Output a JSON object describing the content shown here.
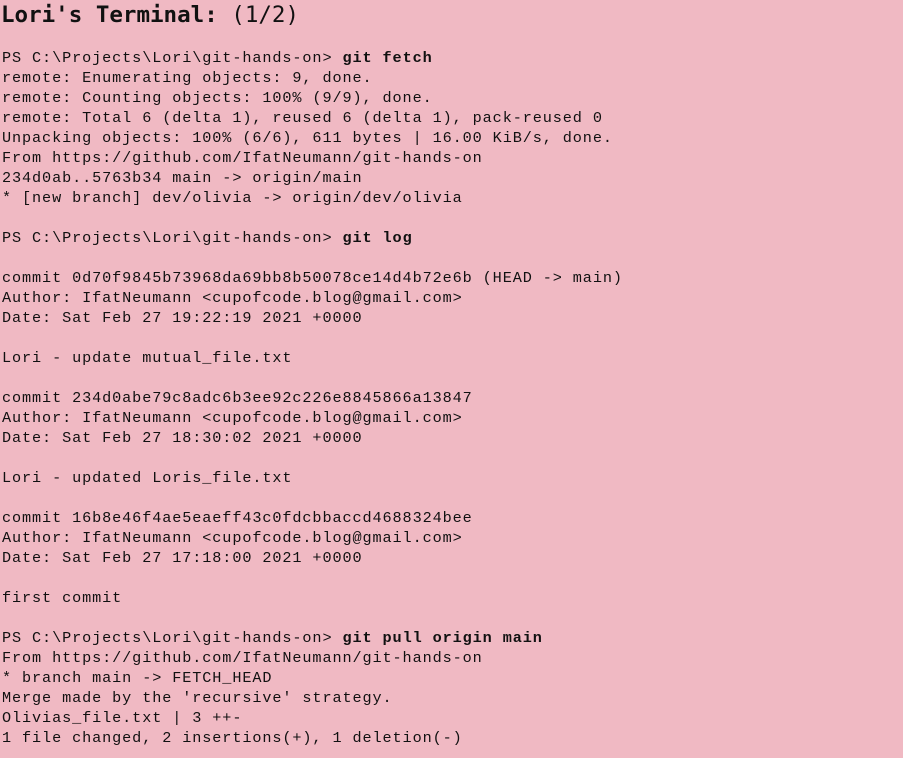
{
  "window": {
    "title": "Lori's Terminal:",
    "page_indicator": "(1/2)"
  },
  "terminal": {
    "lines": [
      {
        "prompt": "PS C:\\Projects\\Lori\\git-hands-on> ",
        "command": "git fetch"
      },
      {
        "text": "remote: Enumerating objects: 9, done."
      },
      {
        "text": "remote: Counting objects: 100% (9/9), done."
      },
      {
        "text": "remote: Total 6 (delta 1), reused 6 (delta 1), pack-reused 0"
      },
      {
        "text": "Unpacking objects: 100% (6/6), 611 bytes | 16.00 KiB/s, done."
      },
      {
        "text": "From https://github.com/IfatNeumann/git-hands-on"
      },
      {
        "text": "234d0ab..5763b34 main -> origin/main"
      },
      {
        "text": "* [new branch] dev/olivia -> origin/dev/olivia"
      },
      {
        "text": ""
      },
      {
        "prompt": "PS C:\\Projects\\Lori\\git-hands-on> ",
        "command": "git log"
      },
      {
        "text": ""
      },
      {
        "text": "commit 0d70f9845b73968da69bb8b50078ce14d4b72e6b (HEAD -> main)"
      },
      {
        "text": "Author: IfatNeumann <cupofcode.blog@gmail.com>"
      },
      {
        "text": "Date: Sat Feb 27 19:22:19 2021 +0000"
      },
      {
        "text": ""
      },
      {
        "text": "Lori - update mutual_file.txt"
      },
      {
        "text": ""
      },
      {
        "text": "commit 234d0abe79c8adc6b3ee92c226e8845866a13847"
      },
      {
        "text": "Author: IfatNeumann <cupofcode.blog@gmail.com>"
      },
      {
        "text": "Date: Sat Feb 27 18:30:02 2021 +0000"
      },
      {
        "text": ""
      },
      {
        "text": "Lori - updated Loris_file.txt"
      },
      {
        "text": ""
      },
      {
        "text": "commit 16b8e46f4ae5eaeff43c0fdcbbaccd4688324bee"
      },
      {
        "text": "Author: IfatNeumann <cupofcode.blog@gmail.com>"
      },
      {
        "text": "Date: Sat Feb 27 17:18:00 2021 +0000"
      },
      {
        "text": ""
      },
      {
        "text": "first commit"
      },
      {
        "text": ""
      },
      {
        "prompt": "PS C:\\Projects\\Lori\\git-hands-on> ",
        "command": "git pull origin main"
      },
      {
        "text": "From https://github.com/IfatNeumann/git-hands-on"
      },
      {
        "text": "* branch main -> FETCH_HEAD"
      },
      {
        "text": "Merge made by the 'recursive' strategy."
      },
      {
        "text": "Olivias_file.txt | 3 ++-"
      },
      {
        "text": "1 file changed, 2 insertions(+), 1 deletion(-)"
      }
    ]
  }
}
